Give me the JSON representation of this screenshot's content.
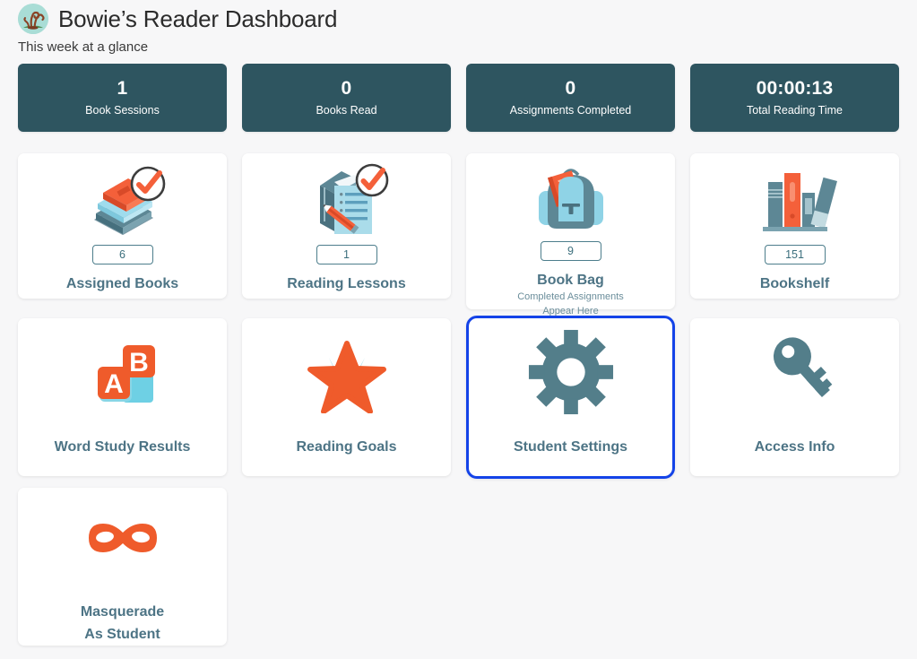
{
  "header": {
    "avatar_icon": "student-avatar-tree-icon",
    "title": "Bowie’s Reader Dashboard",
    "subtitle": "This week at a glance"
  },
  "colors": {
    "page_background": "#f7f7f8",
    "stat_card_background": "#2e5560",
    "tile_background": "#ffffff",
    "tile_label": "#4d7485",
    "accent_orange": "#ef5b2b",
    "accent_light_blue": "#a9dcea",
    "focus_ring_blue": "#1443e8",
    "badge_border": "#4d7e8c"
  },
  "stats": [
    {
      "value": "1",
      "label": "Book Sessions",
      "name": "book-sessions"
    },
    {
      "value": "0",
      "label": "Books Read",
      "name": "books-read"
    },
    {
      "value": "0",
      "label": "Assignments Completed",
      "name": "assignments-completed"
    },
    {
      "value": "00:00:13",
      "label": "Total Reading Time",
      "name": "total-reading-time"
    }
  ],
  "tiles": {
    "assigned_books": {
      "label": "Assigned Books",
      "count": "6",
      "icon": "stacked-books-check-icon"
    },
    "reading_lessons": {
      "label": "Reading Lessons",
      "count": "1",
      "icon": "clipboard-pencil-check-icon"
    },
    "book_bag": {
      "label": "Book Bag",
      "count": "9",
      "sub_line_1": "Completed Assignments",
      "sub_line_2": "Appear Here",
      "icon": "backpack-icon"
    },
    "bookshelf": {
      "label": "Bookshelf",
      "count": "151",
      "icon": "bookshelf-icon"
    },
    "word_study_results": {
      "label": "Word Study Results",
      "icon": "letter-blocks-ab-icon"
    },
    "reading_goals": {
      "label": "Reading Goals",
      "icon": "star-icon"
    },
    "student_settings": {
      "label": "Student Settings",
      "icon": "gear-icon",
      "focused": true
    },
    "access_info": {
      "label": "Access Info",
      "icon": "key-icon"
    },
    "masquerade": {
      "label_line_1": "Masquerade",
      "label_line_2": "As Student",
      "icon": "masquerade-mask-icon"
    }
  }
}
